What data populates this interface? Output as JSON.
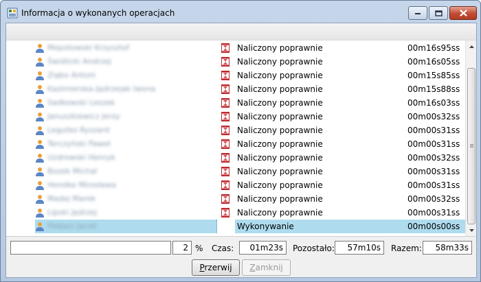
{
  "window": {
    "title": "Informacja o wykonanych operacjach"
  },
  "rows": [
    {
      "name": "Mepotowski Krzysztof",
      "status": "Naliczony poprawnie",
      "time": "00m16s95ss",
      "done": true
    },
    {
      "name": "Świdlicki Andrzej",
      "status": "Naliczony poprawnie",
      "time": "00m16s05ss",
      "done": true
    },
    {
      "name": "Ziąbo Antoni",
      "status": "Naliczony poprawnie",
      "time": "00m15s85ss",
      "done": true
    },
    {
      "name": "Kazimierska-Jędrzejak Iwona",
      "status": "Naliczony poprawnie",
      "time": "00m15s88ss",
      "done": true
    },
    {
      "name": "Sadkowski Leszek",
      "status": "Naliczony poprawnie",
      "time": "00m16s03ss",
      "done": true
    },
    {
      "name": "Januszkiewicz Jerzy",
      "status": "Naliczony poprawnie",
      "time": "00m00s32ss",
      "done": true
    },
    {
      "name": "Legutko Ryszard",
      "status": "Naliczony poprawnie",
      "time": "00m00s31ss",
      "done": true
    },
    {
      "name": "Terczyński Paweł",
      "status": "Naliczony poprawnie",
      "time": "00m00s31ss",
      "done": true
    },
    {
      "name": "Uzdrowski Henryk",
      "status": "Naliczony poprawnie",
      "time": "00m00s32ss",
      "done": true
    },
    {
      "name": "Bozek Michał",
      "status": "Naliczony poprawnie",
      "time": "00m00s31ss",
      "done": true
    },
    {
      "name": "Hendke Mirosława",
      "status": "Naliczony poprawnie",
      "time": "00m00s31ss",
      "done": true
    },
    {
      "name": "Madej Marek",
      "status": "Naliczony poprawnie",
      "time": "00m00s32ss",
      "done": true
    },
    {
      "name": "Lipski Jędrzej",
      "status": "Naliczony poprawnie",
      "time": "00m00s31ss",
      "done": true
    },
    {
      "name": "Piekarz Jacek",
      "status": "Wykonywanie",
      "time": "00m00s00ss",
      "done": false,
      "selected": true
    }
  ],
  "progress": {
    "percent_value": "2",
    "percent_sign": "%",
    "czas_label": "Czas:",
    "czas_value": "01m23s",
    "pozostalo_label": "Pozostało:",
    "pozostalo_value": "57m10s",
    "razem_label": "Razem:",
    "razem_value": "58m33s"
  },
  "buttons": {
    "stop_label": "Przerwij",
    "stop_underline": "P",
    "close_label": "Zamknij",
    "close_underline": "Z"
  },
  "colors": {
    "selection": "#aedcee",
    "status_icon": "#c0282d",
    "person_icon": "#e8a03c"
  },
  "icons": {
    "app": "report-icon",
    "person": "person-icon",
    "status": "hourglass-icon",
    "minimize": "minimize-icon",
    "maximize": "maximize-icon",
    "close": "close-icon"
  }
}
